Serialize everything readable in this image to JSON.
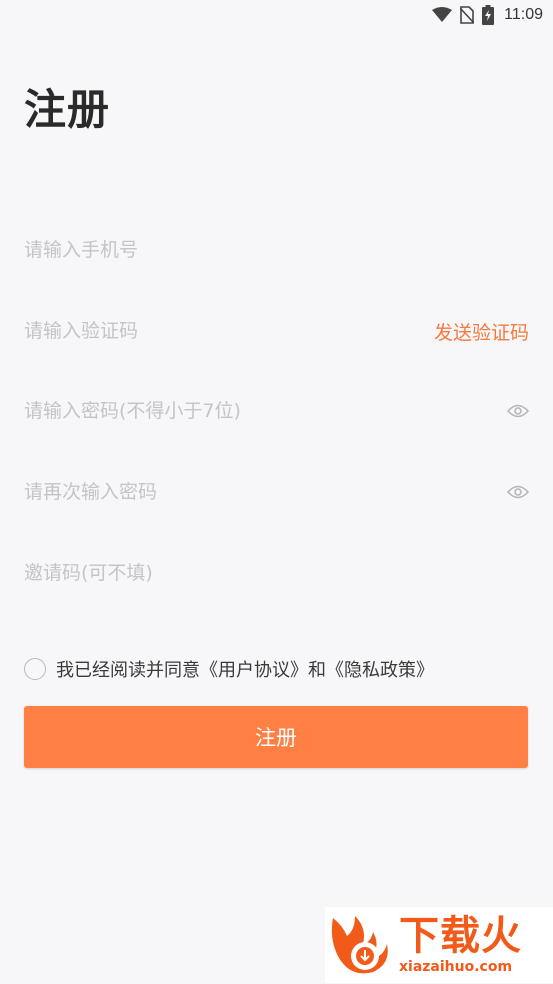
{
  "status_bar": {
    "time": "11:09",
    "icons": [
      "wifi-icon",
      "no-sim-icon",
      "battery-charging-icon"
    ]
  },
  "page": {
    "title": "注册"
  },
  "form": {
    "phone": {
      "placeholder": "请输入手机号",
      "value": ""
    },
    "code": {
      "placeholder": "请输入验证码",
      "value": "",
      "send_label": "发送验证码"
    },
    "password": {
      "placeholder": "请输入密码(不得小于7位)",
      "value": ""
    },
    "confirm_password": {
      "placeholder": "请再次输入密码",
      "value": ""
    },
    "invite": {
      "placeholder": "邀请码(可不填)",
      "value": ""
    }
  },
  "agreement": {
    "checked": false,
    "prefix": "我已经阅读并同意",
    "user_agreement": "《用户协议》",
    "and": "和",
    "privacy_policy": "《隐私政策》"
  },
  "submit": {
    "label": "注册"
  },
  "watermark": {
    "title": "下载火",
    "url": "xiazaihuo.com"
  },
  "colors": {
    "accent": "#ff7f45",
    "link": "#f47a3f",
    "background": "#f7f7f9",
    "placeholder": "#c3c4c8"
  }
}
